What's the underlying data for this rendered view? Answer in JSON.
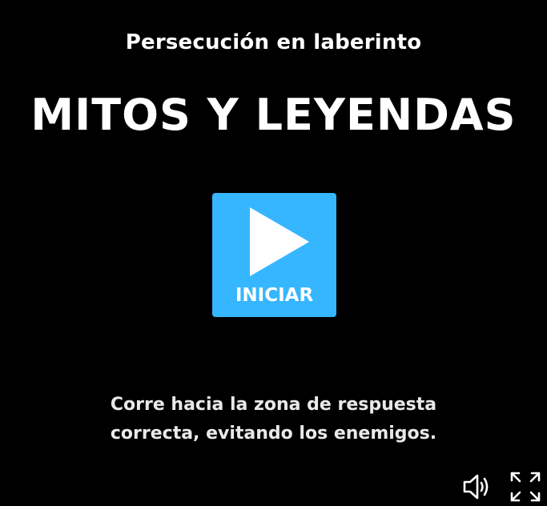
{
  "game": {
    "subtitle": "Persecución en laberinto",
    "title": "MITOS Y LEYENDAS",
    "start_label": "INICIAR",
    "instructions": [
      "Corre hacia la zona de respuesta",
      "correcta, evitando los enemigos."
    ]
  },
  "controls": {
    "sound_icon": "speaker-icon",
    "fullscreen_icon": "fullscreen-icon"
  },
  "colors": {
    "background": "#000000",
    "accent": "#36b6ff",
    "text": "#ffffff"
  }
}
